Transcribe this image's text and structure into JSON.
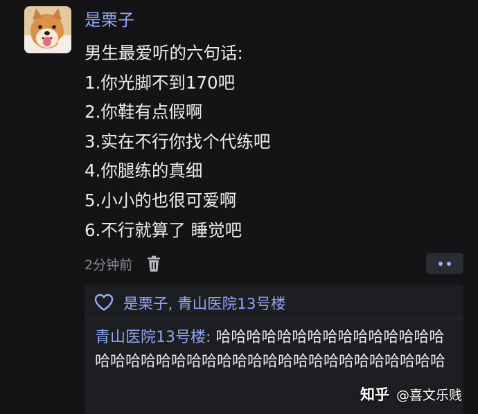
{
  "comment": {
    "username": "是栗子",
    "lines": [
      "男生最爱听的六句话:",
      "1.你光脚不到170吧",
      "2.你鞋有点假啊",
      "3.实在不行你找个代练吧",
      "4.你腿练的真细",
      "5.小小的也很可爱啊",
      "6.不行就算了 睡觉吧"
    ],
    "time": "2分钟前",
    "delete_icon": "trash-icon",
    "more_icon": "more-dots-icon"
  },
  "reply_box": {
    "like_icon": "heart-icon",
    "likers": "是栗子, 青山医院13号楼",
    "reply": {
      "author": "青山医院13号楼:",
      "text": " 哈哈哈哈哈哈哈哈哈哈哈哈哈哈哈哈哈哈哈哈哈哈哈哈哈哈哈哈哈哈哈哈哈哈哈哈哈哈"
    }
  },
  "watermark": {
    "logo": "知乎",
    "user": "@喜文乐贱"
  },
  "colors": {
    "background": "#141416",
    "link_blue": "#8fa7f5",
    "text": "#ececee",
    "muted": "#8a8a90",
    "panel": "#1d1e22",
    "button": "#2a2c33"
  }
}
